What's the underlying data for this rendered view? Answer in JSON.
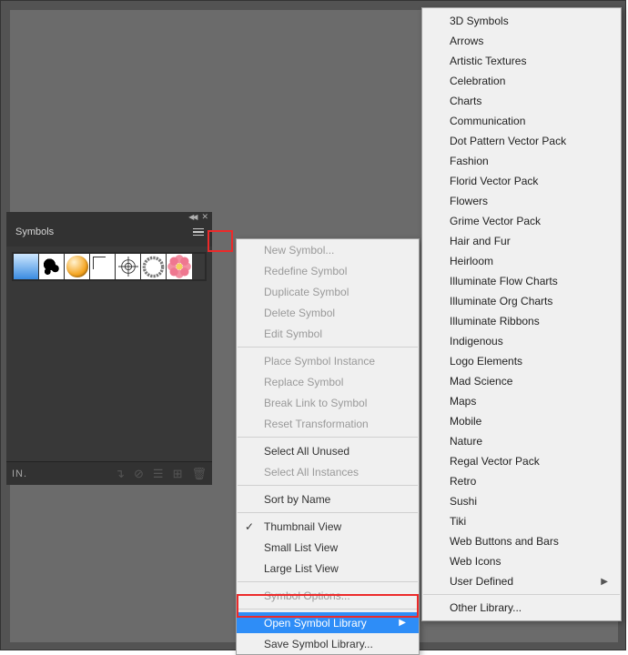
{
  "panel": {
    "title": "Symbols",
    "symbols": [
      "blue-gradient",
      "ink-blot",
      "orange-orb",
      "corner-arrow",
      "registration-mark",
      "gear-ring",
      "pink-flower"
    ],
    "footer_left": "IN."
  },
  "flyout": {
    "items": [
      {
        "label": "New Symbol...",
        "disabled": true
      },
      {
        "label": "Redefine Symbol",
        "disabled": true
      },
      {
        "label": "Duplicate Symbol",
        "disabled": true
      },
      {
        "label": "Delete Symbol",
        "disabled": true
      },
      {
        "label": "Edit Symbol",
        "disabled": true
      },
      {
        "sep": true
      },
      {
        "label": "Place Symbol Instance",
        "disabled": true
      },
      {
        "label": "Replace Symbol",
        "disabled": true
      },
      {
        "label": "Break Link to Symbol",
        "disabled": true
      },
      {
        "label": "Reset Transformation",
        "disabled": true
      },
      {
        "sep": true
      },
      {
        "label": "Select All Unused"
      },
      {
        "label": "Select All Instances",
        "disabled": true
      },
      {
        "sep": true
      },
      {
        "label": "Sort by Name"
      },
      {
        "sep": true
      },
      {
        "label": "Thumbnail View",
        "checked": true
      },
      {
        "label": "Small List View"
      },
      {
        "label": "Large List View"
      },
      {
        "sep": true
      },
      {
        "label": "Symbol Options...",
        "disabled": true
      },
      {
        "sep": true
      },
      {
        "label": "Open Symbol Library",
        "arrow": true,
        "selected": true
      },
      {
        "label": "Save Symbol Library..."
      }
    ]
  },
  "submenu": {
    "items": [
      {
        "label": "3D Symbols"
      },
      {
        "label": "Arrows"
      },
      {
        "label": "Artistic Textures"
      },
      {
        "label": "Celebration"
      },
      {
        "label": "Charts"
      },
      {
        "label": "Communication"
      },
      {
        "label": "Dot Pattern Vector Pack"
      },
      {
        "label": "Fashion"
      },
      {
        "label": "Florid Vector Pack"
      },
      {
        "label": "Flowers"
      },
      {
        "label": "Grime Vector Pack"
      },
      {
        "label": "Hair and Fur"
      },
      {
        "label": "Heirloom"
      },
      {
        "label": "Illuminate Flow Charts"
      },
      {
        "label": "Illuminate Org Charts"
      },
      {
        "label": "Illuminate Ribbons"
      },
      {
        "label": "Indigenous"
      },
      {
        "label": "Logo Elements"
      },
      {
        "label": "Mad Science"
      },
      {
        "label": "Maps"
      },
      {
        "label": "Mobile"
      },
      {
        "label": "Nature"
      },
      {
        "label": "Regal Vector Pack"
      },
      {
        "label": "Retro"
      },
      {
        "label": "Sushi"
      },
      {
        "label": "Tiki"
      },
      {
        "label": "Web Buttons and Bars"
      },
      {
        "label": "Web Icons"
      },
      {
        "label": "User Defined",
        "arrow": true
      },
      {
        "sep": true
      },
      {
        "label": "Other Library..."
      }
    ]
  }
}
